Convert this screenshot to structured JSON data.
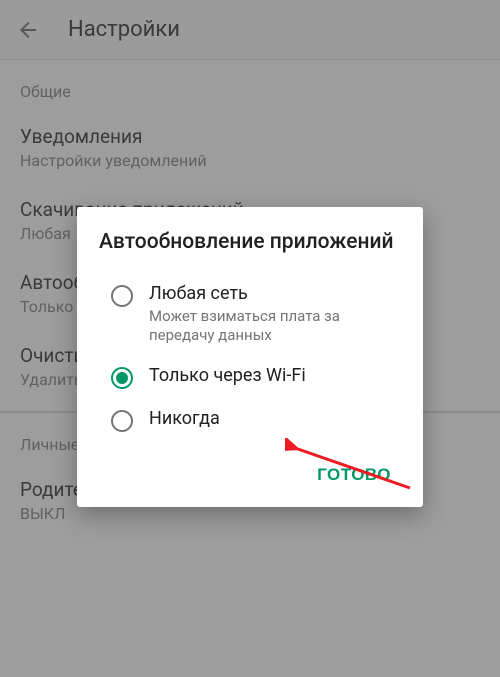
{
  "header": {
    "title": "Настройки"
  },
  "sections": {
    "general_label": "Общие",
    "notifications": {
      "title": "Уведомления",
      "sub": "Настройки уведомлений"
    },
    "downloads": {
      "title": "Скачивание приложений",
      "sub": "Любая"
    },
    "autoupdate": {
      "title": "Автообновление приложений",
      "sub": "Только"
    },
    "clear": {
      "title": "Очистить историю поиска",
      "sub": "Удалить все поисковые запросы с этого устройства"
    },
    "personal_label": "Личные",
    "parental": {
      "title": "Родительский контроль",
      "sub": "ВЫКЛ"
    }
  },
  "dialog": {
    "title": "Автообновление приложений",
    "options": [
      {
        "label": "Любая сеть",
        "desc": "Может взиматься плата за передачу данных",
        "selected": false
      },
      {
        "label": "Только через Wi-Fi",
        "desc": "",
        "selected": true
      },
      {
        "label": "Никогда",
        "desc": "",
        "selected": false
      }
    ],
    "done": "ГОТОВО"
  }
}
